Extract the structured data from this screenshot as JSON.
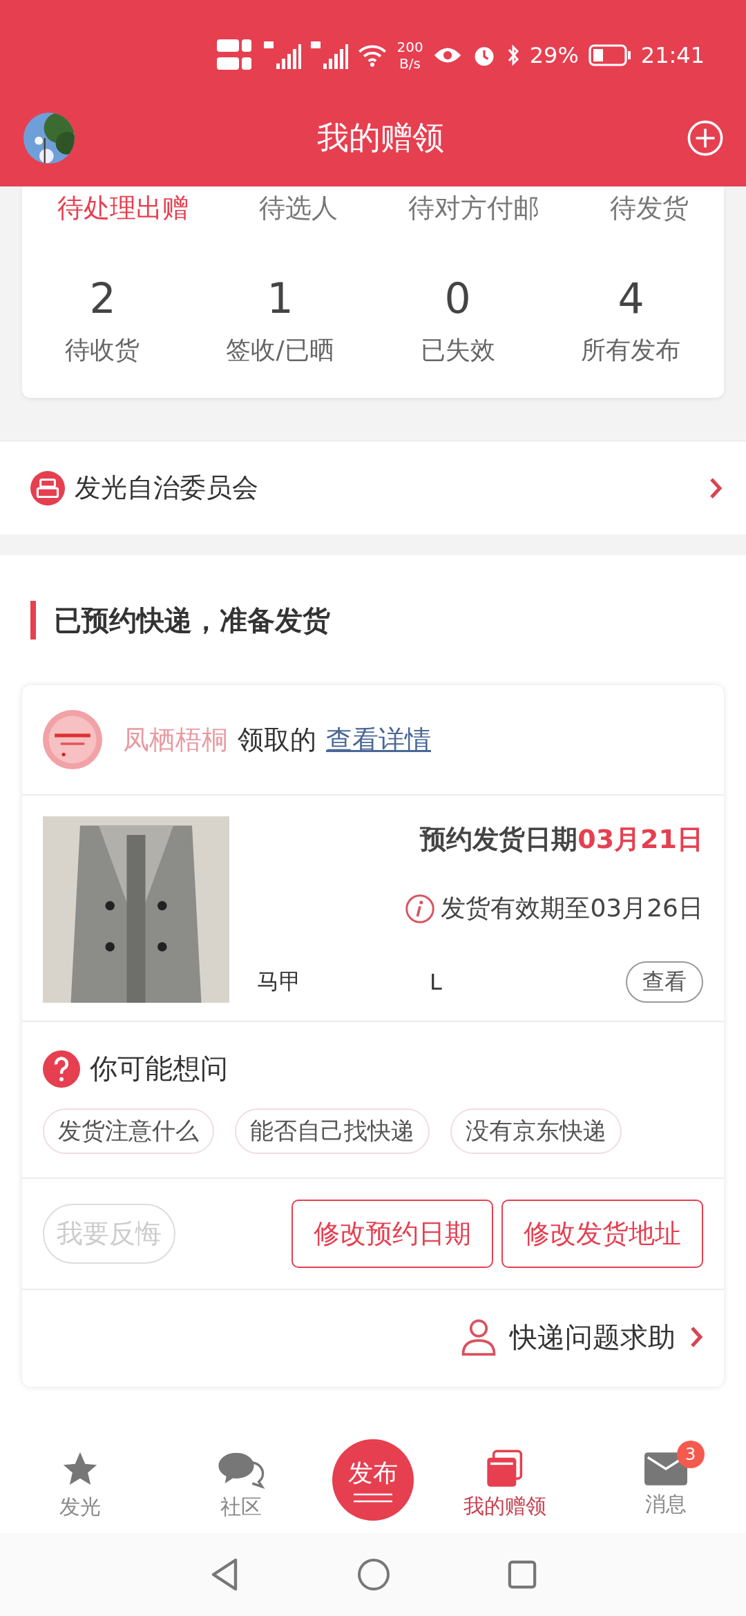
{
  "status_bar": {
    "net_speed": [
      "200",
      "B/s"
    ],
    "battery": "29%",
    "time": "21:41"
  },
  "header": {
    "title": "我的赠领"
  },
  "tabs": [
    {
      "label": "待处理出赠",
      "selected": true
    },
    {
      "label": "待选人",
      "selected": false
    },
    {
      "label": "待对方付邮",
      "selected": false
    },
    {
      "label": "待发货",
      "selected": false
    }
  ],
  "stats": [
    {
      "value": "2",
      "label": "待收货"
    },
    {
      "value": "1",
      "label": "签收/已晒"
    },
    {
      "value": "0",
      "label": "已失效"
    },
    {
      "value": "4",
      "label": "所有发布"
    }
  ],
  "committee": {
    "label": "发光自治委员会"
  },
  "section": {
    "title": "已预约快递，准备发货"
  },
  "order": {
    "receiver": "凤栖梧桐",
    "action": "领取的",
    "link": "查看详情",
    "ship_date_label": "预约发货日期",
    "ship_date": "03月21日",
    "valid_until": "发货有效期至03月26日",
    "item_name": "马甲",
    "item_size": "L",
    "view_button": "查看",
    "faq_title": "你可能想问",
    "faq": [
      "发货注意什么",
      "能否自己找快递",
      "没有京东快递"
    ],
    "actions": [
      {
        "label": "我要反悔",
        "disabled": true
      },
      {
        "label": "修改预约日期",
        "disabled": false
      },
      {
        "label": "修改发货地址",
        "disabled": false
      }
    ],
    "help": "快递问题求助"
  },
  "bottom_nav": [
    {
      "kind": "star",
      "label": "发光",
      "selected": false
    },
    {
      "kind": "chat",
      "label": "社区",
      "selected": false
    },
    {
      "kind": "publish",
      "label": "发布",
      "selected": false
    },
    {
      "kind": "gift",
      "label": "我的赠领",
      "selected": true
    },
    {
      "kind": "mail",
      "label": "消息",
      "selected": false,
      "badge": "3"
    }
  ]
}
